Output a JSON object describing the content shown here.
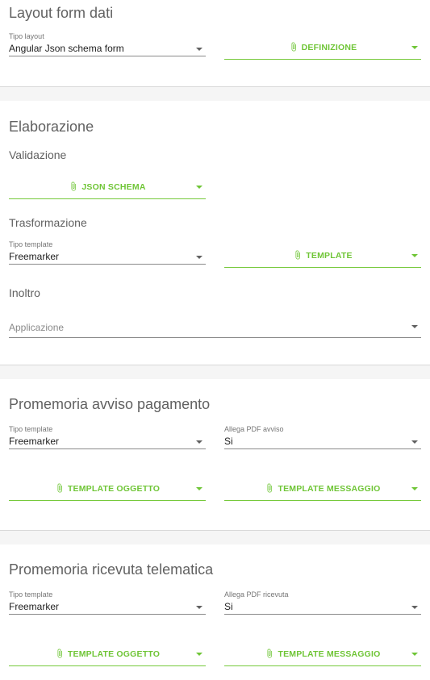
{
  "layout": {
    "title": "Layout form dati",
    "tipo_layout": {
      "label": "Tipo layout",
      "value": "Angular Json schema form"
    },
    "definizione_button": "DEFINIZIONE"
  },
  "elaborazione": {
    "title": "Elaborazione",
    "validazione": {
      "title": "Validazione",
      "json_schema_button": "JSON SCHEMA"
    },
    "trasformazione": {
      "title": "Trasformazione",
      "tipo_template": {
        "label": "Tipo template",
        "value": "Freemarker"
      },
      "template_button": "TEMPLATE"
    },
    "inoltro": {
      "title": "Inoltro",
      "applicazione": {
        "placeholder": "Applicazione"
      }
    }
  },
  "promemoria_avviso": {
    "title": "Promemoria avviso pagamento",
    "tipo_template": {
      "label": "Tipo template",
      "value": "Freemarker"
    },
    "allega_pdf": {
      "label": "Allega PDF avviso",
      "value": "Si"
    },
    "template_oggetto_button": "TEMPLATE OGGETTO",
    "template_messaggio_button": "TEMPLATE MESSAGGIO"
  },
  "promemoria_ricevuta": {
    "title": "Promemoria ricevuta telematica",
    "tipo_template": {
      "label": "Tipo template",
      "value": "Freemarker"
    },
    "allega_pdf": {
      "label": "Allega PDF ricevuta",
      "value": "Si"
    },
    "template_oggetto_button": "TEMPLATE OGGETTO",
    "template_messaggio_button": "TEMPLATE MESSAGGIO"
  },
  "colors": {
    "accent": "#6fc536",
    "text": "#212121",
    "muted": "#616161",
    "separator": "#f5f5f5"
  },
  "icons": {
    "attachment": "paperclip-icon",
    "dropdown": "dropdown-arrow-icon"
  }
}
